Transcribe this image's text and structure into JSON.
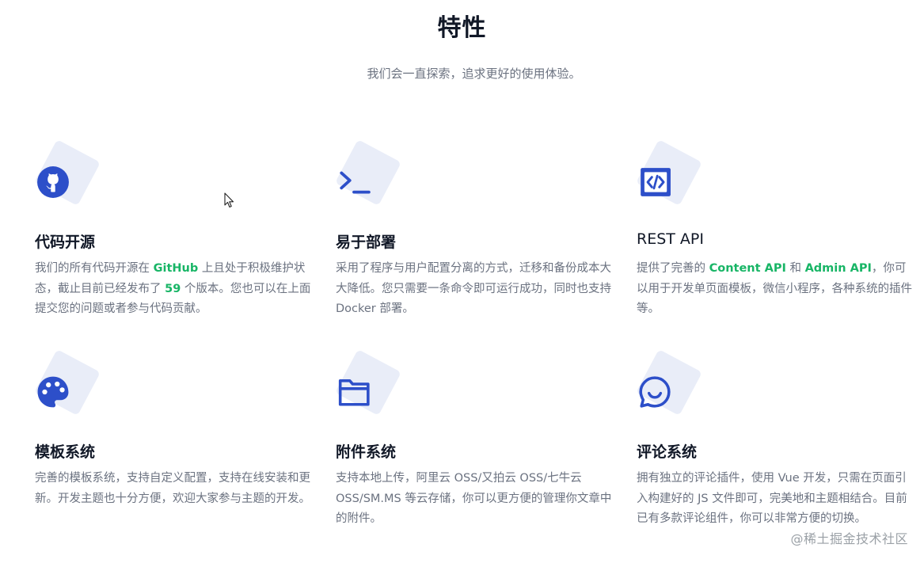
{
  "section": {
    "title": "特性",
    "subtitle": "我们会一直探索，追求更好的使用体验。"
  },
  "features": [
    {
      "title": "代码开源",
      "icon": "github-icon",
      "desc_parts": [
        "我们的所有代码开源在 ",
        "GitHub",
        " 上且处于积极维护状态，截止目前已经发布了 ",
        "59",
        " 个版本。您也可以在上面提交您的问题或者参与代码贡献。"
      ]
    },
    {
      "title": "易于部署",
      "icon": "terminal-icon",
      "desc": "采用了程序与用户配置分离的方式，迁移和备份成本大大降低。您只需要一条命令即可运行成功，同时也支持 Docker 部署。"
    },
    {
      "title": "REST API",
      "icon": "code-icon",
      "desc_parts": [
        "提供了完善的 ",
        "Content API",
        " 和 ",
        "Admin API",
        "，你可以用于开发单页面模板，微信小程序，各种系统的插件等。"
      ]
    },
    {
      "title": "模板系统",
      "icon": "palette-icon",
      "desc": "完善的模板系统，支持自定义配置，支持在线安装和更新。开发主题也十分方便，欢迎大家参与主题的开发。"
    },
    {
      "title": "附件系统",
      "icon": "folder-icon",
      "desc": "支持本地上传，阿里云 OSS/又拍云 OSS/七牛云 OSS/SM.MS 等云存储，你可以更方便的管理你文章中的附件。"
    },
    {
      "title": "评论系统",
      "icon": "chat-icon",
      "desc": "拥有独立的评论插件，使用 Vue 开发，只需在页面引入构建好的 JS 文件即可，完美地和主题相结合。目前已有多款评论组件，你可以非常方便的切换。"
    }
  ],
  "watermark": "@稀土掘金技术社区",
  "colors": {
    "accent": "#2d4fc9",
    "highlight": "#18b566",
    "icon_bg": "#e9edf8"
  }
}
